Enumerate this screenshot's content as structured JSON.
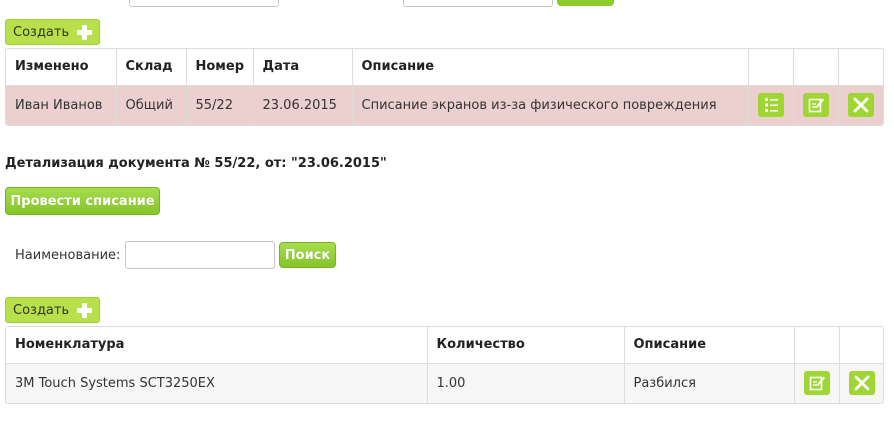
{
  "top_partial": {
    "select_value": "",
    "input_value": "",
    "button_label": ""
  },
  "documents": {
    "create_label": "Создать",
    "columns": [
      "Изменено",
      "Склад",
      "Номер",
      "Дата",
      "Описание"
    ],
    "rows": [
      {
        "changed_by": "Иван Иванов",
        "warehouse": "Общий",
        "number": "55/22",
        "date": "23.06.2015",
        "description": "Списание экранов из-за физического повреждения",
        "highlight_color": "#ecd0d0"
      }
    ],
    "action_icons": [
      "list-icon",
      "edit-icon",
      "delete-icon"
    ]
  },
  "detail": {
    "title": "Детализация документа № 55/22, от: \"23.06.2015\"",
    "writeoff_button": "Провести списание",
    "search": {
      "label": "Наименование:",
      "value": "",
      "button": "Поиск"
    },
    "create_label": "Создать",
    "columns": [
      "Номенклатура",
      "Количество",
      "Описание"
    ],
    "rows": [
      {
        "nomenclature": "3M Touch Systems SCT3250EX",
        "quantity": "1.00",
        "description": "Разбился"
      }
    ],
    "action_icons": [
      "edit-icon",
      "delete-icon"
    ]
  },
  "colors": {
    "accent_green": "#9fd634",
    "button_green": "#86c52a",
    "row_highlight": "#ecd0d0"
  }
}
